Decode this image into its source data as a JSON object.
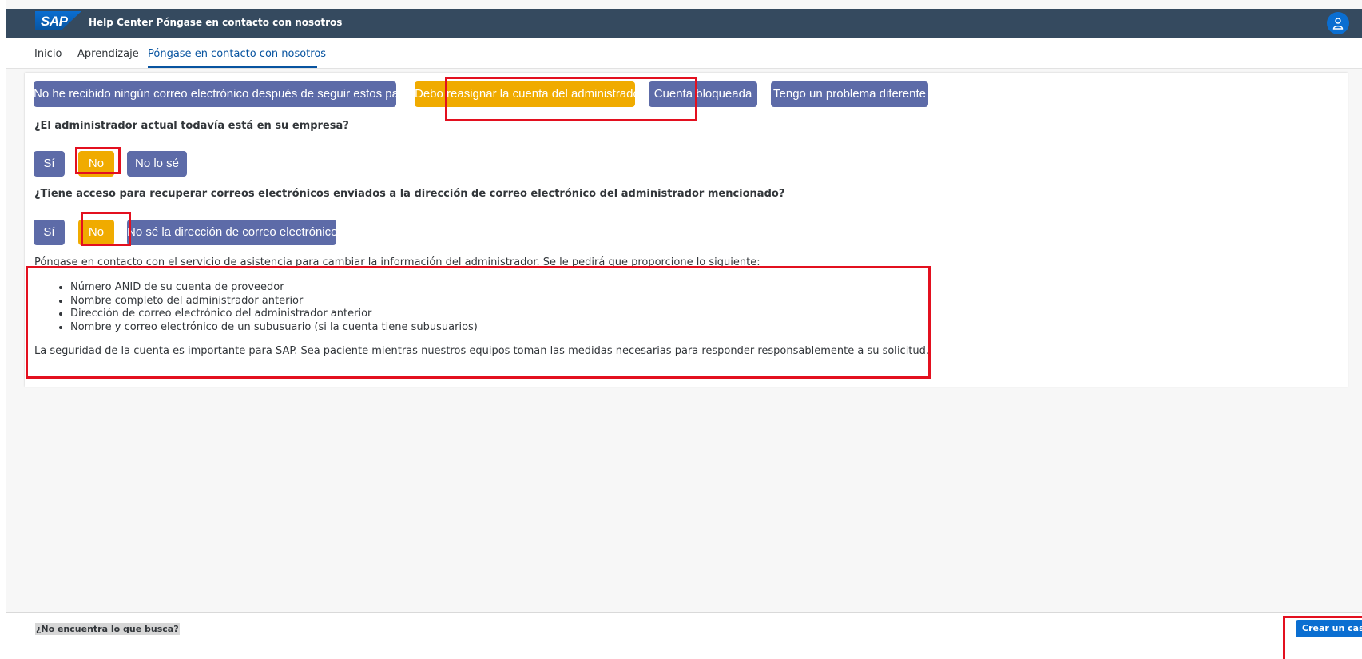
{
  "header": {
    "logo_text": "SAP",
    "title": "Help Center Póngase en contacto con nosotros",
    "avatar_icon": "user-icon"
  },
  "tabs": [
    {
      "label": "Inicio",
      "active": false
    },
    {
      "label": "Aprendizaje",
      "active": false
    },
    {
      "label": "Póngase en contacto con nosotros",
      "active": true
    }
  ],
  "topics": [
    {
      "label": "No he recibido ningún correo electrónico después de seguir estos pasos",
      "selected": false
    },
    {
      "label": "Debo reasignar la cuenta del administrador",
      "selected": true
    },
    {
      "label": "Cuenta bloqueada",
      "selected": false
    },
    {
      "label": "Tengo un problema diferente",
      "selected": false
    }
  ],
  "q1": {
    "text": "¿El administrador actual todavía está en su empresa?",
    "options": [
      {
        "label": "Sí",
        "selected": false
      },
      {
        "label": "No",
        "selected": true
      },
      {
        "label": "No lo sé",
        "selected": false
      }
    ]
  },
  "q2": {
    "text": "¿Tiene acceso para recuperar correos electrónicos enviados a la dirección de correo electrónico del administrador mencionado?",
    "options": [
      {
        "label": "Sí",
        "selected": false
      },
      {
        "label": "No",
        "selected": true
      },
      {
        "label": "No sé la dirección de correo electrónico",
        "selected": false
      }
    ]
  },
  "instructions": "Póngase en contacto con el servicio de asistencia para cambiar la información del administrador. Se le pedirá que proporcione lo siguiente:",
  "requirements": [
    "Número ANID de su cuenta de proveedor",
    "Nombre completo del administrador anterior",
    "Dirección de correo electrónico del administrador anterior",
    "Nombre y correo electrónico de un subusuario (si la cuenta tiene subusuarios)"
  ],
  "note": "La seguridad de la cuenta es importante para SAP. Sea paciente mientras nuestros equipos toman las medidas necesarias para responder responsablemente a su solicitud.",
  "footer": {
    "prompt": "¿No encuentra lo que busca?",
    "create_label": "Crear un caso"
  },
  "colors": {
    "shellbar": "#354a5f",
    "button": "#5d6ba8",
    "selected": "#f0ab00",
    "highlight": "#e3101f",
    "primary": "#0a6ed1"
  }
}
